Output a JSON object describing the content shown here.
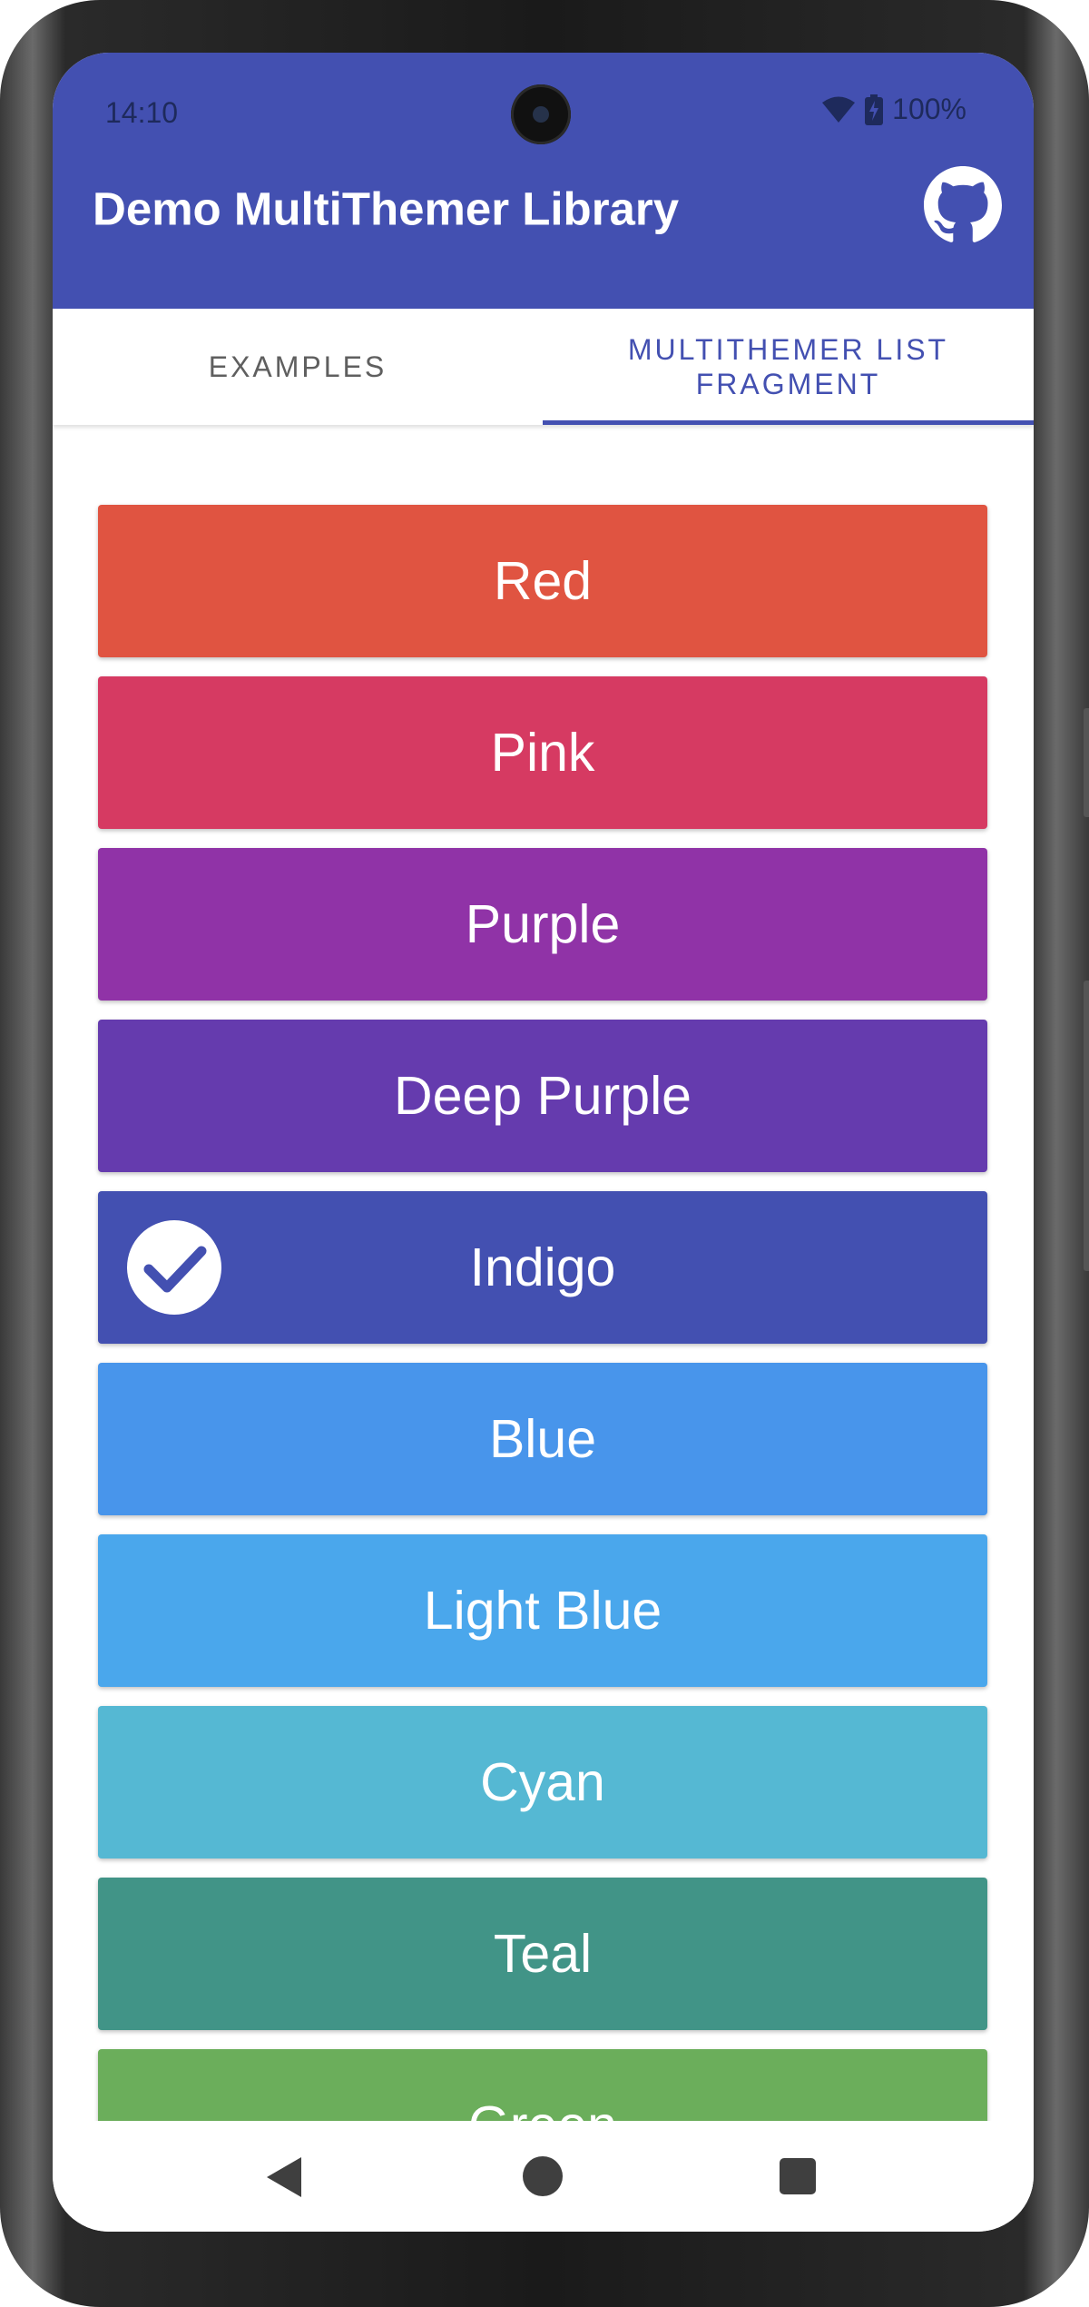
{
  "status_bar": {
    "time": "14:10",
    "battery": "100%"
  },
  "app_bar": {
    "title": "Demo MultiThemer Library",
    "action_icon": "github-icon"
  },
  "tabs": [
    {
      "label": "EXAMPLES",
      "selected": false
    },
    {
      "label": "MULTITHEMER LIST FRAGMENT",
      "selected": true
    }
  ],
  "colors": {
    "primary": "#4350b1",
    "status_text": "#1e2a5c"
  },
  "themes": [
    {
      "label": "Red",
      "color": "#e05441",
      "selected": false
    },
    {
      "label": "Pink",
      "color": "#d63a62",
      "selected": false
    },
    {
      "label": "Purple",
      "color": "#9033a7",
      "selected": false
    },
    {
      "label": "Deep Purple",
      "color": "#653bae",
      "selected": false
    },
    {
      "label": "Indigo",
      "color": "#4350b1",
      "selected": true
    },
    {
      "label": "Blue",
      "color": "#4895eb",
      "selected": false
    },
    {
      "label": "Light Blue",
      "color": "#4aa7ec",
      "selected": false
    },
    {
      "label": "Cyan",
      "color": "#55b8d3",
      "selected": false
    },
    {
      "label": "Teal",
      "color": "#419487",
      "selected": false
    },
    {
      "label": "Green",
      "color": "#6bae5b",
      "selected": false
    }
  ],
  "nav_bar": {
    "back_icon": "back-icon",
    "home_icon": "home-icon",
    "recents_icon": "recents-icon"
  }
}
